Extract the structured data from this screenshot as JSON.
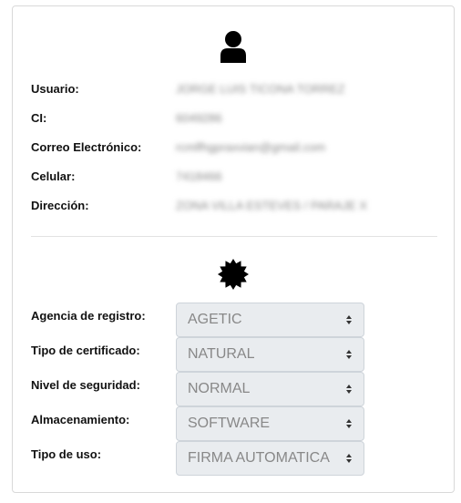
{
  "user": {
    "fields": [
      {
        "label": "Usuario:",
        "value": "JORGE LUIS TICONA TORREZ"
      },
      {
        "label": "CI:",
        "value": "6049286"
      },
      {
        "label": "Correo Electrónico:",
        "value": "rcmlfhgpraxvian@gmail.com"
      },
      {
        "label": "Celular:",
        "value": "7418466"
      },
      {
        "label": "Dirección:",
        "value": "ZONA VILLA ESTEVES / PARAJE X"
      }
    ]
  },
  "certificate": {
    "fields": [
      {
        "label": "Agencia de registro:",
        "value": "AGETIC"
      },
      {
        "label": "Tipo de certificado:",
        "value": "NATURAL"
      },
      {
        "label": "Nivel de seguridad:",
        "value": "NORMAL"
      },
      {
        "label": "Almacenamiento:",
        "value": "SOFTWARE"
      },
      {
        "label": "Tipo de uso:",
        "value": "FIRMA AUTOMATICA"
      }
    ]
  },
  "icons": {
    "user": "user-icon",
    "certificate": "certificate-seal-icon"
  }
}
